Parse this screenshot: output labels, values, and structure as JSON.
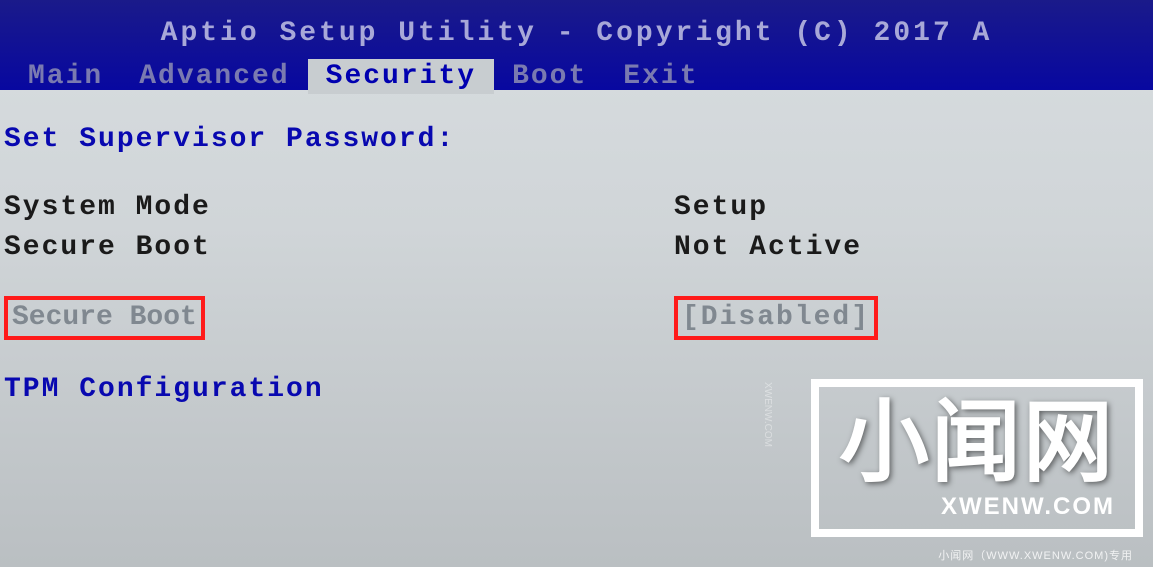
{
  "header": {
    "copyright": "Aptio Setup Utility - Copyright (C) 2017 A"
  },
  "menu": {
    "items": [
      {
        "label": "Main",
        "active": false
      },
      {
        "label": "Advanced",
        "active": false
      },
      {
        "label": "Security",
        "active": true
      },
      {
        "label": "Boot",
        "active": false
      },
      {
        "label": "Exit",
        "active": false
      }
    ]
  },
  "security": {
    "set_supervisor_label": "Set Supervisor Password:",
    "system_mode_label": "System Mode",
    "system_mode_value": "Setup",
    "secure_boot_status_label": "Secure Boot",
    "secure_boot_status_value": "Not Active",
    "secure_boot_option_label": "Secure Boot",
    "secure_boot_option_value": "[Disabled]",
    "tpm_config_label": "TPM Configuration"
  },
  "watermark": {
    "title": "小闻网",
    "url": "XWENW.COM",
    "small": "小闻网（WWW.XWENW.COM)专用",
    "vertical": "XWENW.COM"
  }
}
